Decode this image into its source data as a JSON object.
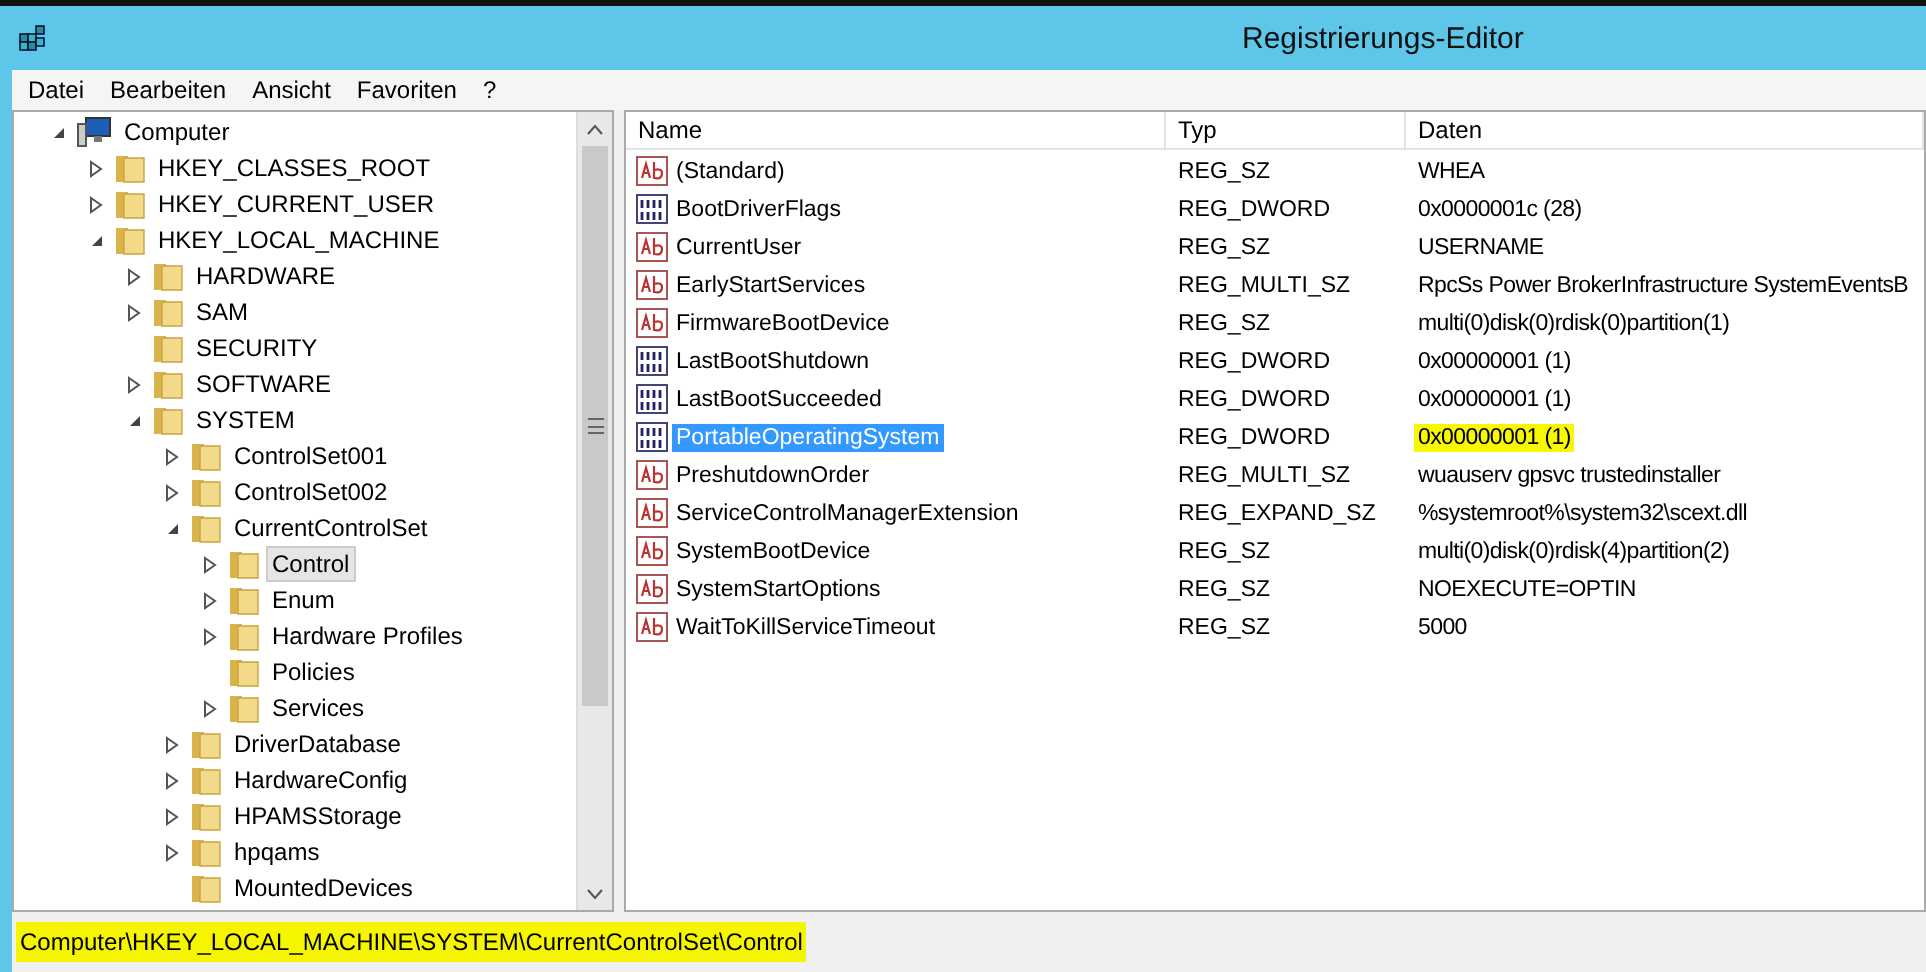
{
  "window": {
    "title": "Registrierungs-Editor"
  },
  "menu": [
    "Datei",
    "Bearbeiten",
    "Ansicht",
    "Favoriten",
    "?"
  ],
  "tree": [
    {
      "label": "Computer",
      "kind": "computer",
      "expandable": true,
      "expanded": true,
      "selected": false,
      "children": [
        {
          "label": "HKEY_CLASSES_ROOT",
          "kind": "folder",
          "expandable": true,
          "expanded": false,
          "selected": false
        },
        {
          "label": "HKEY_CURRENT_USER",
          "kind": "folder",
          "expandable": true,
          "expanded": false,
          "selected": false
        },
        {
          "label": "HKEY_LOCAL_MACHINE",
          "kind": "folder",
          "expandable": true,
          "expanded": true,
          "selected": false,
          "children": [
            {
              "label": "HARDWARE",
              "kind": "folder",
              "expandable": true,
              "expanded": false,
              "selected": false
            },
            {
              "label": "SAM",
              "kind": "folder",
              "expandable": true,
              "expanded": false,
              "selected": false
            },
            {
              "label": "SECURITY",
              "kind": "folder",
              "expandable": false,
              "selected": false
            },
            {
              "label": "SOFTWARE",
              "kind": "folder",
              "expandable": true,
              "expanded": false,
              "selected": false
            },
            {
              "label": "SYSTEM",
              "kind": "folder",
              "expandable": true,
              "expanded": true,
              "selected": false,
              "children": [
                {
                  "label": "ControlSet001",
                  "kind": "folder",
                  "expandable": true,
                  "expanded": false,
                  "selected": false
                },
                {
                  "label": "ControlSet002",
                  "kind": "folder",
                  "expandable": true,
                  "expanded": false,
                  "selected": false
                },
                {
                  "label": "CurrentControlSet",
                  "kind": "folder",
                  "expandable": true,
                  "expanded": true,
                  "selected": false,
                  "children": [
                    {
                      "label": "Control",
                      "kind": "folder",
                      "expandable": true,
                      "expanded": false,
                      "selected": true
                    },
                    {
                      "label": "Enum",
                      "kind": "folder",
                      "expandable": true,
                      "expanded": false,
                      "selected": false
                    },
                    {
                      "label": "Hardware Profiles",
                      "kind": "folder",
                      "expandable": true,
                      "expanded": false,
                      "selected": false
                    },
                    {
                      "label": "Policies",
                      "kind": "folder",
                      "expandable": false,
                      "selected": false
                    },
                    {
                      "label": "Services",
                      "kind": "folder",
                      "expandable": true,
                      "expanded": false,
                      "selected": false
                    }
                  ]
                },
                {
                  "label": "DriverDatabase",
                  "kind": "folder",
                  "expandable": true,
                  "expanded": false,
                  "selected": false
                },
                {
                  "label": "HardwareConfig",
                  "kind": "folder",
                  "expandable": true,
                  "expanded": false,
                  "selected": false
                },
                {
                  "label": "HPAMSStorage",
                  "kind": "folder",
                  "expandable": true,
                  "expanded": false,
                  "selected": false
                },
                {
                  "label": "hpqams",
                  "kind": "folder",
                  "expandable": true,
                  "expanded": false,
                  "selected": false
                },
                {
                  "label": "MountedDevices",
                  "kind": "folder",
                  "expandable": false,
                  "selected": false
                }
              ]
            }
          ]
        }
      ]
    }
  ],
  "table": {
    "columns": [
      "Name",
      "Typ",
      "Daten"
    ],
    "rows": [
      {
        "kind": "string",
        "name": "(Standard)",
        "type": "REG_SZ",
        "data": "WHEA",
        "selected": false,
        "highlighted": false
      },
      {
        "kind": "binary",
        "name": "BootDriverFlags",
        "type": "REG_DWORD",
        "data": "0x0000001c (28)",
        "selected": false,
        "highlighted": false
      },
      {
        "kind": "string",
        "name": "CurrentUser",
        "type": "REG_SZ",
        "data": "USERNAME",
        "selected": false,
        "highlighted": false
      },
      {
        "kind": "string",
        "name": "EarlyStartServices",
        "type": "REG_MULTI_SZ",
        "data": "RpcSs Power BrokerInfrastructure SystemEventsB",
        "selected": false,
        "highlighted": false
      },
      {
        "kind": "string",
        "name": "FirmwareBootDevice",
        "type": "REG_SZ",
        "data": "multi(0)disk(0)rdisk(0)partition(1)",
        "selected": false,
        "highlighted": false
      },
      {
        "kind": "binary",
        "name": "LastBootShutdown",
        "type": "REG_DWORD",
        "data": "0x00000001 (1)",
        "selected": false,
        "highlighted": false
      },
      {
        "kind": "binary",
        "name": "LastBootSucceeded",
        "type": "REG_DWORD",
        "data": "0x00000001 (1)",
        "selected": false,
        "highlighted": false
      },
      {
        "kind": "binary",
        "name": "PortableOperatingSystem",
        "type": "REG_DWORD",
        "data": "0x00000001 (1)",
        "selected": true,
        "highlighted": true
      },
      {
        "kind": "string",
        "name": "PreshutdownOrder",
        "type": "REG_MULTI_SZ",
        "data": "wuauserv gpsvc trustedinstaller",
        "selected": false,
        "highlighted": false
      },
      {
        "kind": "string",
        "name": "ServiceControlManagerExtension",
        "type": "REG_EXPAND_SZ",
        "data": "%systemroot%\\system32\\scext.dll",
        "selected": false,
        "highlighted": false
      },
      {
        "kind": "string",
        "name": "SystemBootDevice",
        "type": "REG_SZ",
        "data": "multi(0)disk(0)rdisk(4)partition(2)",
        "selected": false,
        "highlighted": false
      },
      {
        "kind": "string",
        "name": "SystemStartOptions",
        "type": "REG_SZ",
        "data": " NOEXECUTE=OPTIN",
        "selected": false,
        "highlighted": false
      },
      {
        "kind": "string",
        "name": "WaitToKillServiceTimeout",
        "type": "REG_SZ",
        "data": "5000",
        "selected": false,
        "highlighted": false
      }
    ]
  },
  "status_bar": {
    "path": "Computer\\HKEY_LOCAL_MACHINE\\SYSTEM\\CurrentControlSet\\Control",
    "highlighted": true
  }
}
